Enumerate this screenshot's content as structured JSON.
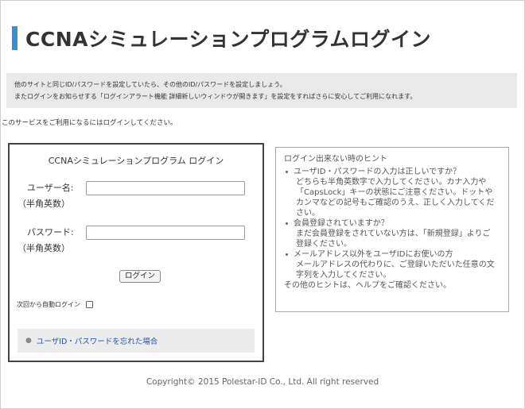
{
  "header": {
    "title": "CCNAシミュレーションプログラムログイン",
    "accent_color": "#3a8fd0"
  },
  "notice": {
    "line1": "他のサイトと同じID/パスワードを設定していたら、その他のID/パスワードを設定しましょう。",
    "line2": "またログインをお知らせする「ログインアラート機能 詳細新しいウィンドウが開きます」を設定をすればさらに安心してご利用になれます。"
  },
  "intro": "このサービスをご利用になるにはログインしてください。",
  "login": {
    "title": "CCNAシミュレーションプログラム ログイン",
    "user_label": "ユーザー名:",
    "user_sub": "（半角英数）",
    "user_value": "",
    "password_label": "パスワード:",
    "password_sub": "（半角英数）",
    "password_value": "",
    "button_label": "ログイン",
    "auto_login_label": "次回から自動ログイン",
    "forgot_link": "ユーザID・パスワードを忘れた場合"
  },
  "hints": {
    "title": "ログイン出来ない時のヒント",
    "items": [
      {
        "question": "ユーザID・パスワードの入力は正しいですか？",
        "answer_lines": [
          "どちらも半角英数字で入力してください。カナ入力や",
          "「CapsLock」キーの状態にご注意ください。ドットや",
          "カンマなどの記号もご確認のうえ、正しく入力してくだ",
          "さい。"
        ]
      },
      {
        "question": "会員登録されていますか？",
        "answer_lines": [
          "まだ会員登録をされていない方は、「新規登録」よりご",
          "登録ください。"
        ]
      },
      {
        "question": "メールアドレス以外をユーザIDにお使いの方",
        "answer_lines": [
          "メールアドレスの代わりに、ご登録いただいた任意の文",
          "字列を入力してください。"
        ]
      }
    ],
    "footer": "その他のヒントは、ヘルプをご確認ください。"
  },
  "footer": {
    "copyright": "Copyright© 2015 Polestar-ID Co., Ltd. All right reserved"
  }
}
